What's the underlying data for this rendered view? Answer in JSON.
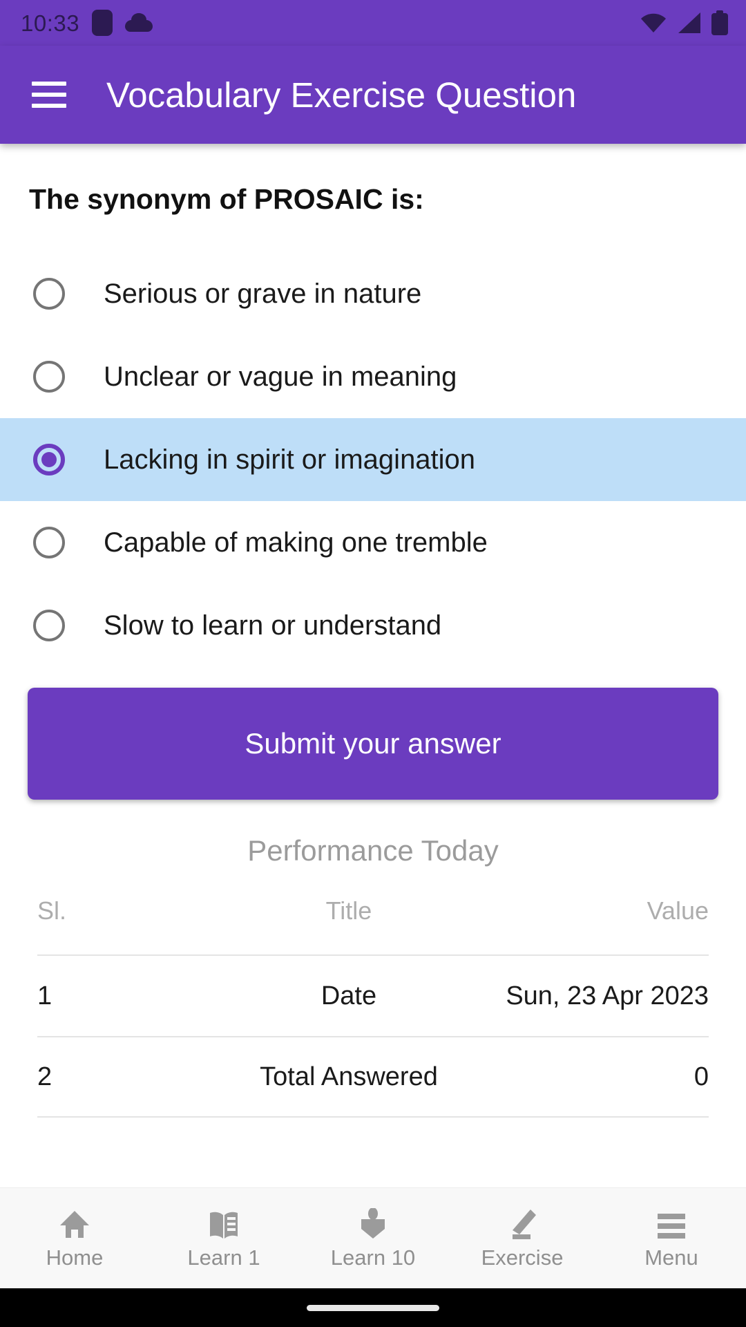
{
  "colors": {
    "primary": "#6B3CBF",
    "status_icon": "#2C1A52",
    "selected_row_bg": "#BEDEF8",
    "muted_text": "#9B9B9B",
    "nav_text": "#8F8F8F"
  },
  "status_bar": {
    "time": "10:33",
    "left_icons": [
      "app-badge-icon",
      "cloud-icon"
    ],
    "right_icons": [
      "wifi-icon",
      "signal-icon",
      "battery-icon"
    ]
  },
  "app_bar": {
    "menu_icon": "hamburger-menu-icon",
    "title": "Vocabulary Exercise Question"
  },
  "question": {
    "text": "The synonym of PROSAIC is:"
  },
  "options": [
    {
      "label": "Serious or grave in nature",
      "selected": false
    },
    {
      "label": "Unclear or vague in meaning",
      "selected": false
    },
    {
      "label": "Lacking in spirit or imagination",
      "selected": true
    },
    {
      "label": "Capable of making one tremble",
      "selected": false
    },
    {
      "label": "Slow to learn or understand",
      "selected": false
    }
  ],
  "submit": {
    "label": "Submit your answer"
  },
  "performance": {
    "title": "Performance Today",
    "columns": [
      "Sl.",
      "Title",
      "Value"
    ],
    "rows": [
      {
        "sl": "1",
        "title": "Date",
        "value": "Sun, 23 Apr 2023"
      },
      {
        "sl": "2",
        "title": "Total Answered",
        "value": "0"
      }
    ]
  },
  "bottom_nav": [
    {
      "label": "Home",
      "icon": "home-icon"
    },
    {
      "label": "Learn 1",
      "icon": "open-book-icon"
    },
    {
      "label": "Learn 10",
      "icon": "bookmark-book-icon"
    },
    {
      "label": "Exercise",
      "icon": "pencil-icon"
    },
    {
      "label": "Menu",
      "icon": "hamburger-menu-icon"
    }
  ]
}
